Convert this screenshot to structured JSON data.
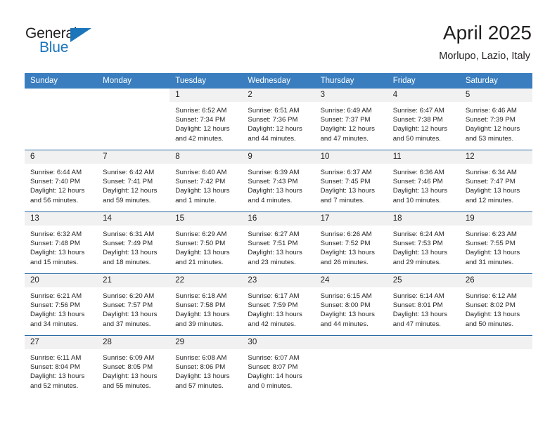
{
  "logo": {
    "word_one": "General",
    "word_two": "Blue",
    "triangle_color": "#1b75bb",
    "icon": "triangle-icon"
  },
  "header": {
    "month_title": "April 2025",
    "location": "Morlupo, Lazio, Italy"
  },
  "theme": {
    "header_bg": "#3a7ebf",
    "row_rule": "#2c6ca4",
    "daynum_bg": "#f1f1f1",
    "text": "#231f20"
  },
  "columns": [
    "Sunday",
    "Monday",
    "Tuesday",
    "Wednesday",
    "Thursday",
    "Friday",
    "Saturday"
  ],
  "weeks": [
    [
      {
        "day": "",
        "lines": []
      },
      {
        "day": "",
        "lines": []
      },
      {
        "day": "1",
        "lines": [
          "Sunrise: 6:52 AM",
          "Sunset: 7:34 PM",
          "Daylight: 12 hours",
          "and 42 minutes."
        ]
      },
      {
        "day": "2",
        "lines": [
          "Sunrise: 6:51 AM",
          "Sunset: 7:36 PM",
          "Daylight: 12 hours",
          "and 44 minutes."
        ]
      },
      {
        "day": "3",
        "lines": [
          "Sunrise: 6:49 AM",
          "Sunset: 7:37 PM",
          "Daylight: 12 hours",
          "and 47 minutes."
        ]
      },
      {
        "day": "4",
        "lines": [
          "Sunrise: 6:47 AM",
          "Sunset: 7:38 PM",
          "Daylight: 12 hours",
          "and 50 minutes."
        ]
      },
      {
        "day": "5",
        "lines": [
          "Sunrise: 6:46 AM",
          "Sunset: 7:39 PM",
          "Daylight: 12 hours",
          "and 53 minutes."
        ]
      }
    ],
    [
      {
        "day": "6",
        "lines": [
          "Sunrise: 6:44 AM",
          "Sunset: 7:40 PM",
          "Daylight: 12 hours",
          "and 56 minutes."
        ]
      },
      {
        "day": "7",
        "lines": [
          "Sunrise: 6:42 AM",
          "Sunset: 7:41 PM",
          "Daylight: 12 hours",
          "and 59 minutes."
        ]
      },
      {
        "day": "8",
        "lines": [
          "Sunrise: 6:40 AM",
          "Sunset: 7:42 PM",
          "Daylight: 13 hours",
          "and 1 minute."
        ]
      },
      {
        "day": "9",
        "lines": [
          "Sunrise: 6:39 AM",
          "Sunset: 7:43 PM",
          "Daylight: 13 hours",
          "and 4 minutes."
        ]
      },
      {
        "day": "10",
        "lines": [
          "Sunrise: 6:37 AM",
          "Sunset: 7:45 PM",
          "Daylight: 13 hours",
          "and 7 minutes."
        ]
      },
      {
        "day": "11",
        "lines": [
          "Sunrise: 6:36 AM",
          "Sunset: 7:46 PM",
          "Daylight: 13 hours",
          "and 10 minutes."
        ]
      },
      {
        "day": "12",
        "lines": [
          "Sunrise: 6:34 AM",
          "Sunset: 7:47 PM",
          "Daylight: 13 hours",
          "and 12 minutes."
        ]
      }
    ],
    [
      {
        "day": "13",
        "lines": [
          "Sunrise: 6:32 AM",
          "Sunset: 7:48 PM",
          "Daylight: 13 hours",
          "and 15 minutes."
        ]
      },
      {
        "day": "14",
        "lines": [
          "Sunrise: 6:31 AM",
          "Sunset: 7:49 PM",
          "Daylight: 13 hours",
          "and 18 minutes."
        ]
      },
      {
        "day": "15",
        "lines": [
          "Sunrise: 6:29 AM",
          "Sunset: 7:50 PM",
          "Daylight: 13 hours",
          "and 21 minutes."
        ]
      },
      {
        "day": "16",
        "lines": [
          "Sunrise: 6:27 AM",
          "Sunset: 7:51 PM",
          "Daylight: 13 hours",
          "and 23 minutes."
        ]
      },
      {
        "day": "17",
        "lines": [
          "Sunrise: 6:26 AM",
          "Sunset: 7:52 PM",
          "Daylight: 13 hours",
          "and 26 minutes."
        ]
      },
      {
        "day": "18",
        "lines": [
          "Sunrise: 6:24 AM",
          "Sunset: 7:53 PM",
          "Daylight: 13 hours",
          "and 29 minutes."
        ]
      },
      {
        "day": "19",
        "lines": [
          "Sunrise: 6:23 AM",
          "Sunset: 7:55 PM",
          "Daylight: 13 hours",
          "and 31 minutes."
        ]
      }
    ],
    [
      {
        "day": "20",
        "lines": [
          "Sunrise: 6:21 AM",
          "Sunset: 7:56 PM",
          "Daylight: 13 hours",
          "and 34 minutes."
        ]
      },
      {
        "day": "21",
        "lines": [
          "Sunrise: 6:20 AM",
          "Sunset: 7:57 PM",
          "Daylight: 13 hours",
          "and 37 minutes."
        ]
      },
      {
        "day": "22",
        "lines": [
          "Sunrise: 6:18 AM",
          "Sunset: 7:58 PM",
          "Daylight: 13 hours",
          "and 39 minutes."
        ]
      },
      {
        "day": "23",
        "lines": [
          "Sunrise: 6:17 AM",
          "Sunset: 7:59 PM",
          "Daylight: 13 hours",
          "and 42 minutes."
        ]
      },
      {
        "day": "24",
        "lines": [
          "Sunrise: 6:15 AM",
          "Sunset: 8:00 PM",
          "Daylight: 13 hours",
          "and 44 minutes."
        ]
      },
      {
        "day": "25",
        "lines": [
          "Sunrise: 6:14 AM",
          "Sunset: 8:01 PM",
          "Daylight: 13 hours",
          "and 47 minutes."
        ]
      },
      {
        "day": "26",
        "lines": [
          "Sunrise: 6:12 AM",
          "Sunset: 8:02 PM",
          "Daylight: 13 hours",
          "and 50 minutes."
        ]
      }
    ],
    [
      {
        "day": "27",
        "lines": [
          "Sunrise: 6:11 AM",
          "Sunset: 8:04 PM",
          "Daylight: 13 hours",
          "and 52 minutes."
        ]
      },
      {
        "day": "28",
        "lines": [
          "Sunrise: 6:09 AM",
          "Sunset: 8:05 PM",
          "Daylight: 13 hours",
          "and 55 minutes."
        ]
      },
      {
        "day": "29",
        "lines": [
          "Sunrise: 6:08 AM",
          "Sunset: 8:06 PM",
          "Daylight: 13 hours",
          "and 57 minutes."
        ]
      },
      {
        "day": "30",
        "lines": [
          "Sunrise: 6:07 AM",
          "Sunset: 8:07 PM",
          "Daylight: 14 hours",
          "and 0 minutes."
        ]
      },
      {
        "day": "",
        "lines": []
      },
      {
        "day": "",
        "lines": []
      },
      {
        "day": "",
        "lines": []
      }
    ]
  ]
}
